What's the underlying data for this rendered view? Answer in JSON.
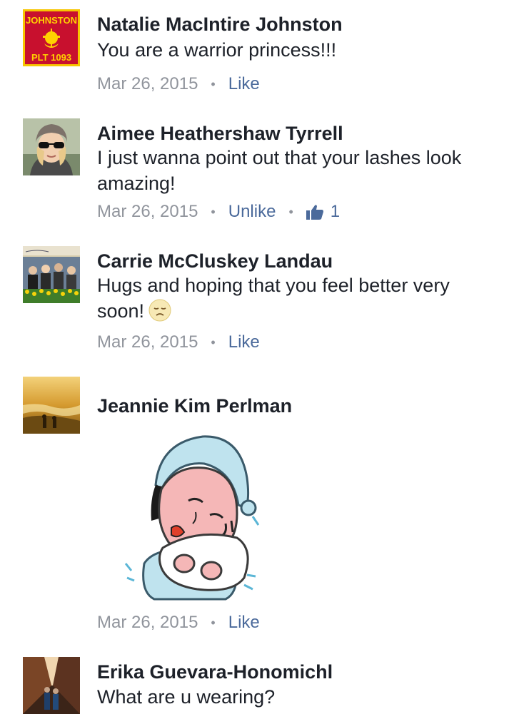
{
  "comments": [
    {
      "author": "Natalie MacIntire Johnston",
      "text": "You are a warrior princess!!!",
      "date": "Mar 26, 2015",
      "action": "Like",
      "avatar": {
        "kind": "logo",
        "top_text": "JOHNSTON",
        "bottom_text": "PLT 1093",
        "bg": "#c8102e",
        "fg": "#ffd200"
      }
    },
    {
      "author": "Aimee Heathershaw Tyrrell",
      "text": "I just wanna point out that your lashes look amazing!",
      "date": "Mar 26, 2015",
      "action": "Unlike",
      "like_count": "1"
    },
    {
      "author": "Carrie McCluskey Landau",
      "text": "Hugs and hoping that you feel better very soon!",
      "date": "Mar 26, 2015",
      "action": "Like",
      "emoji": "disappointed-face"
    },
    {
      "author": "Jeannie Kim Perlman",
      "date": "Mar 26, 2015",
      "action": "Like",
      "sticker": "sick-person-sticker"
    },
    {
      "author": "Erika Guevara-Honomichl",
      "text": "What are u wearing?"
    }
  ],
  "colors": {
    "name": "#1d2129",
    "meta": "#90949c",
    "action": "#4b6a9b"
  }
}
